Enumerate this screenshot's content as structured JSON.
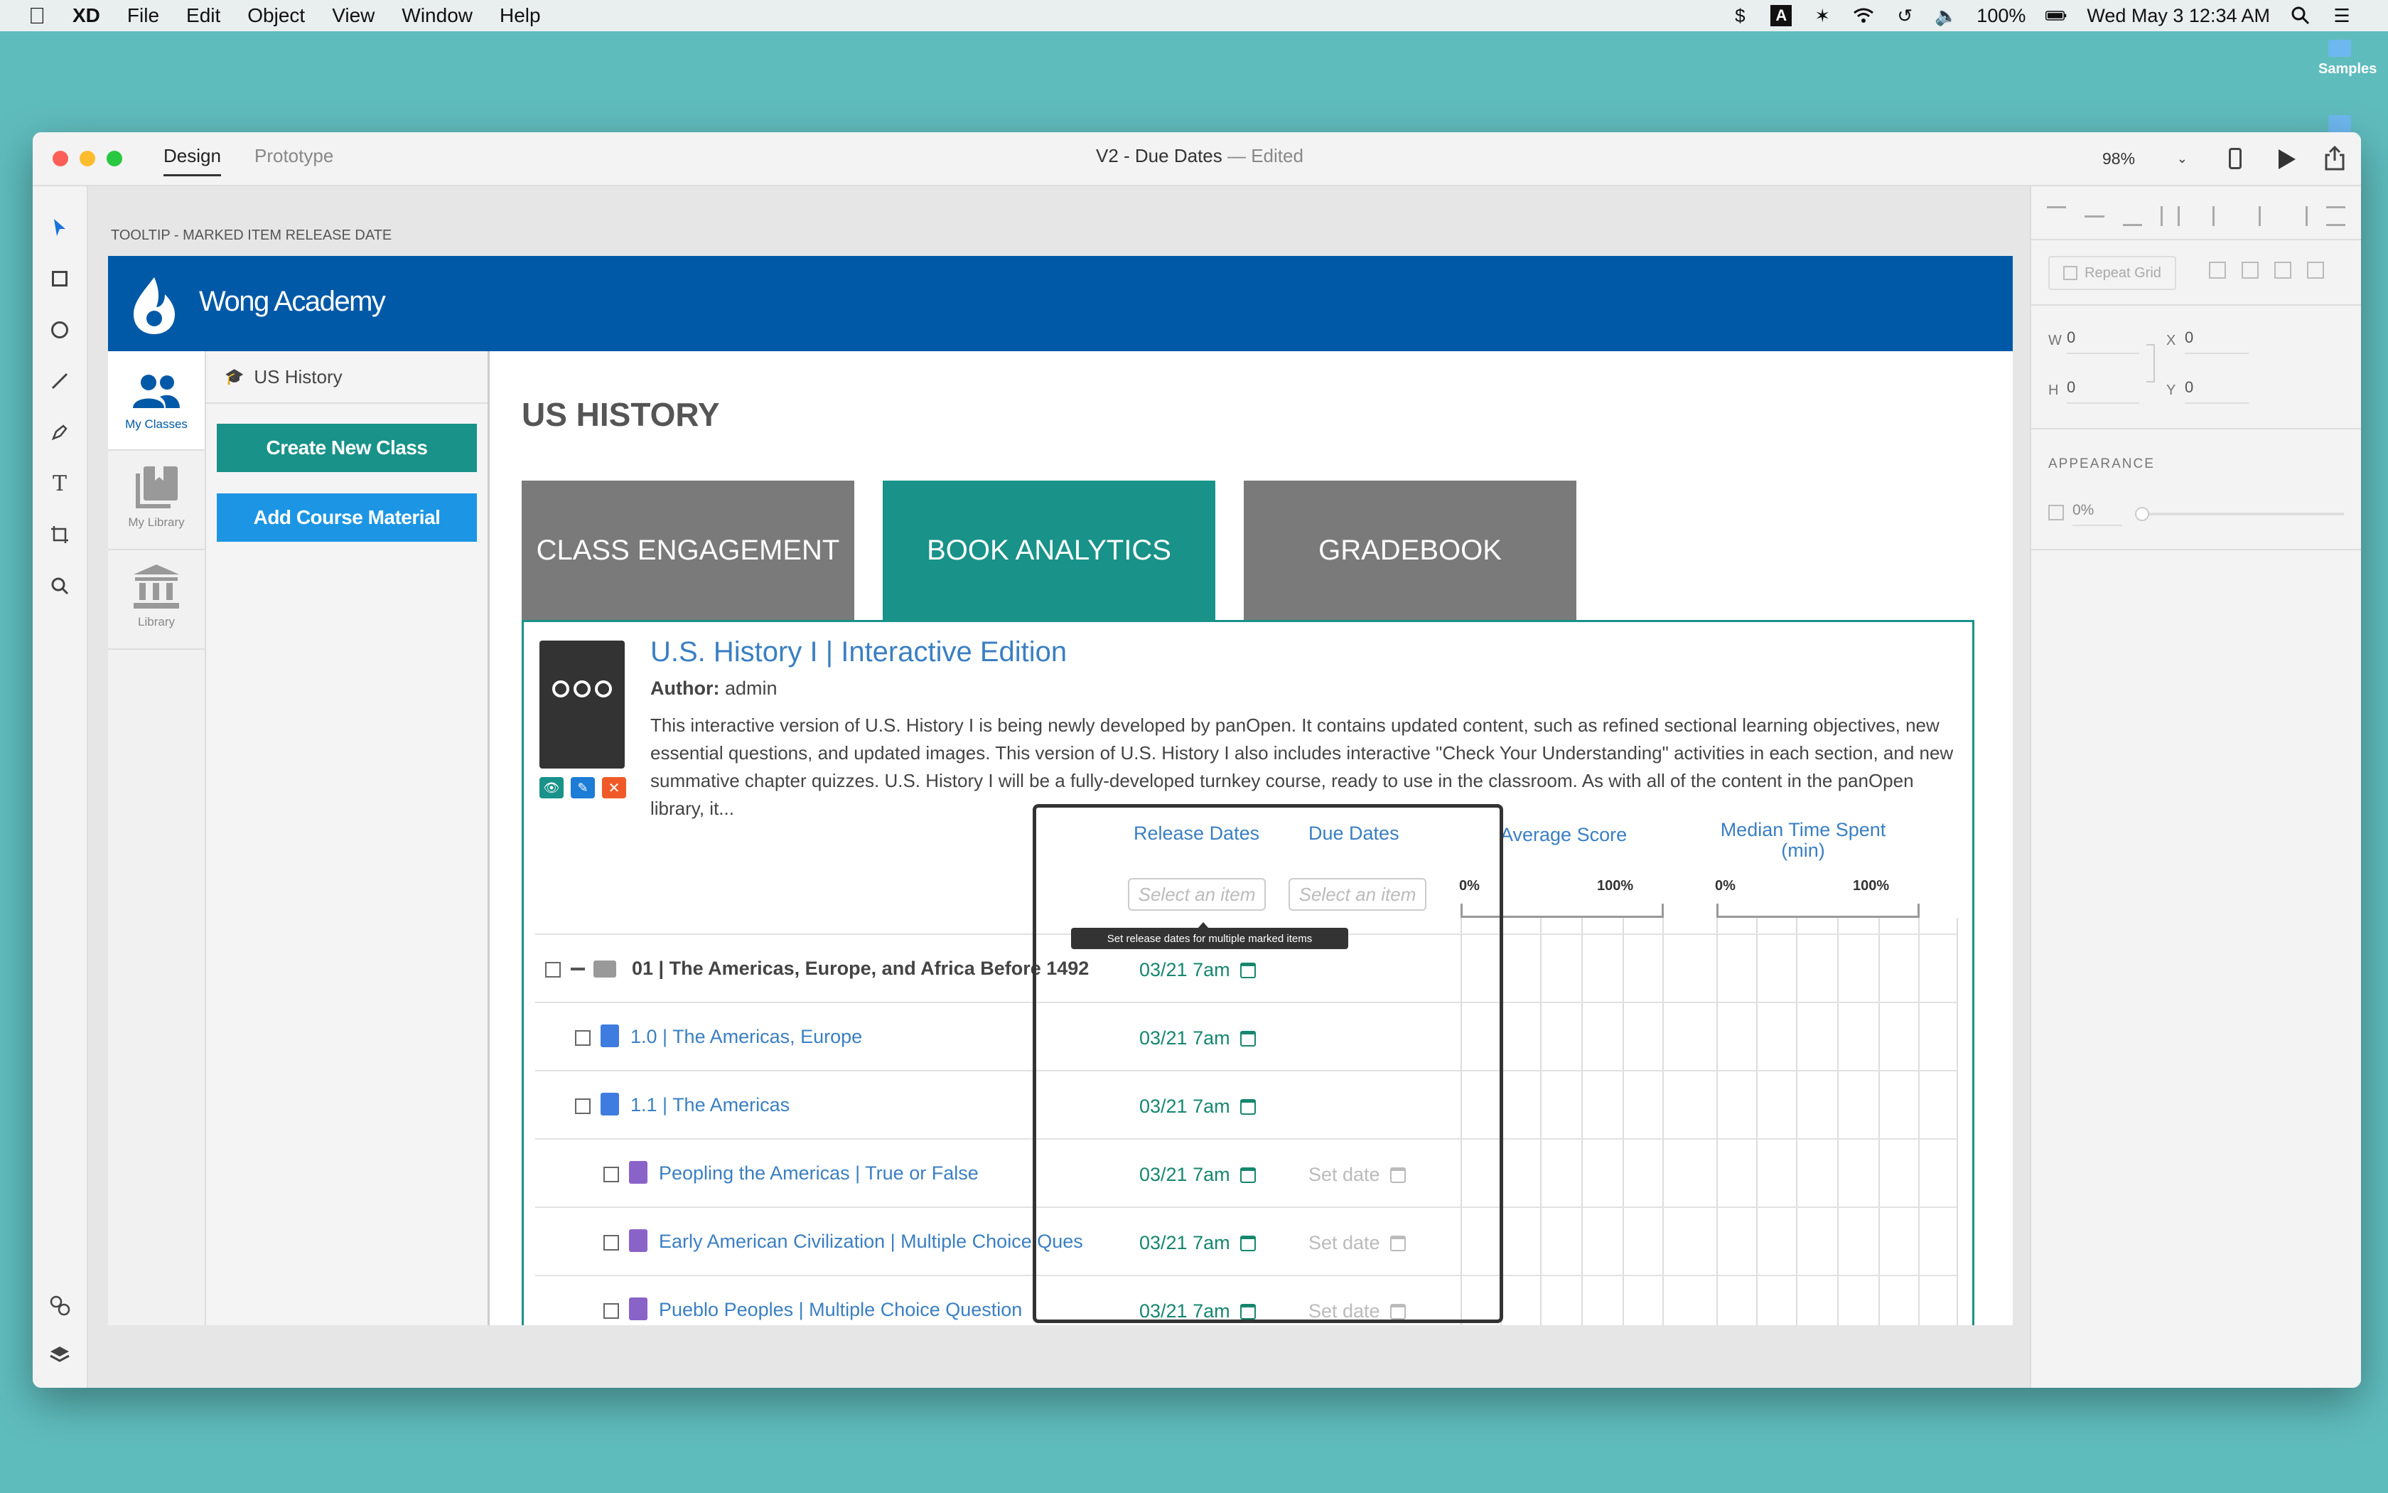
{
  "menubar": {
    "app": "XD",
    "items": [
      "File",
      "Edit",
      "Object",
      "View",
      "Window",
      "Help"
    ],
    "battery": "100%",
    "datetime": "Wed May 3  12:34 AM"
  },
  "desktop": {
    "folder_label": "Samples"
  },
  "window": {
    "tabs": {
      "design": "Design",
      "prototype": "Prototype"
    },
    "doc_title": "V2 - Due Dates",
    "doc_status": "— Edited",
    "zoom": "98%"
  },
  "artboard": {
    "name": "TOOLTIP - MARKED ITEM RELEASE DATE"
  },
  "app": {
    "brand": "Wong Academy",
    "nav": [
      {
        "label": "My Classes",
        "icon": "users-icon"
      },
      {
        "label": "My Library",
        "icon": "books-icon"
      },
      {
        "label": "Library",
        "icon": "bank-icon"
      }
    ],
    "sidebar_tab": "US History",
    "create_class": "Create New Class",
    "add_material": "Add Course Material",
    "page_title": "US HISTORY",
    "tabs": [
      "CLASS ENGAGEMENT",
      "BOOK ANALYTICS",
      "GRADEBOOK"
    ],
    "book": {
      "title": "U.S. History I | Interactive Edition",
      "author_label": "Author:",
      "author": "admin",
      "description": "This interactive version of U.S. History I is being newly developed by panOpen. It contains updated content, such as refined sectional learning objectives, new essential questions, and updated images. This version of U.S. History I also includes interactive \"Check Your Understanding\" activities in each section, and new summative chapter quizzes. U.S. History I will be a fully-developed turnkey course, ready to use in the classroom. As with all of the content in the panOpen library, it..."
    },
    "columns": {
      "release": "Release Dates",
      "due": "Due Dates",
      "avg": "Average Score",
      "median": "Median Time Spent",
      "median_unit": "(min)",
      "pct_min": "0%",
      "pct_max": "100%"
    },
    "select_placeholder": "Select an item",
    "tooltip": "Set release dates for multiple marked items",
    "rows": [
      {
        "title": "01 | The Americas, Europe, and Africa Before 1492",
        "release": "03/21 7am",
        "due": ""
      },
      {
        "title": "1.0 | The Americas, Europe",
        "release": "03/21 7am",
        "due": ""
      },
      {
        "title": "1.1 | The Americas",
        "release": "03/21 7am",
        "due": ""
      },
      {
        "title": "Peopling the Americas | True or False",
        "release": "03/21 7am",
        "due": "Set date"
      },
      {
        "title": "Early American Civilization | Multiple Choice Ques",
        "release": "03/21 7am",
        "due": "Set date"
      },
      {
        "title": "Pueblo Peoples | Multiple Choice Question",
        "release": "03/21 7am",
        "due": "Set date"
      }
    ]
  },
  "right_panel": {
    "repeat_grid": "Repeat Grid",
    "w_label": "W",
    "w": "0",
    "h_label": "H",
    "h": "0",
    "x_label": "X",
    "x": "0",
    "y_label": "Y",
    "y": "0",
    "appearance": "APPEARANCE",
    "opacity": "0%"
  },
  "colors": {
    "brand_blue": "#0059a7",
    "teal": "#199289",
    "btn_blue": "#1c96e4",
    "tab_gray": "#7a7a7a"
  }
}
